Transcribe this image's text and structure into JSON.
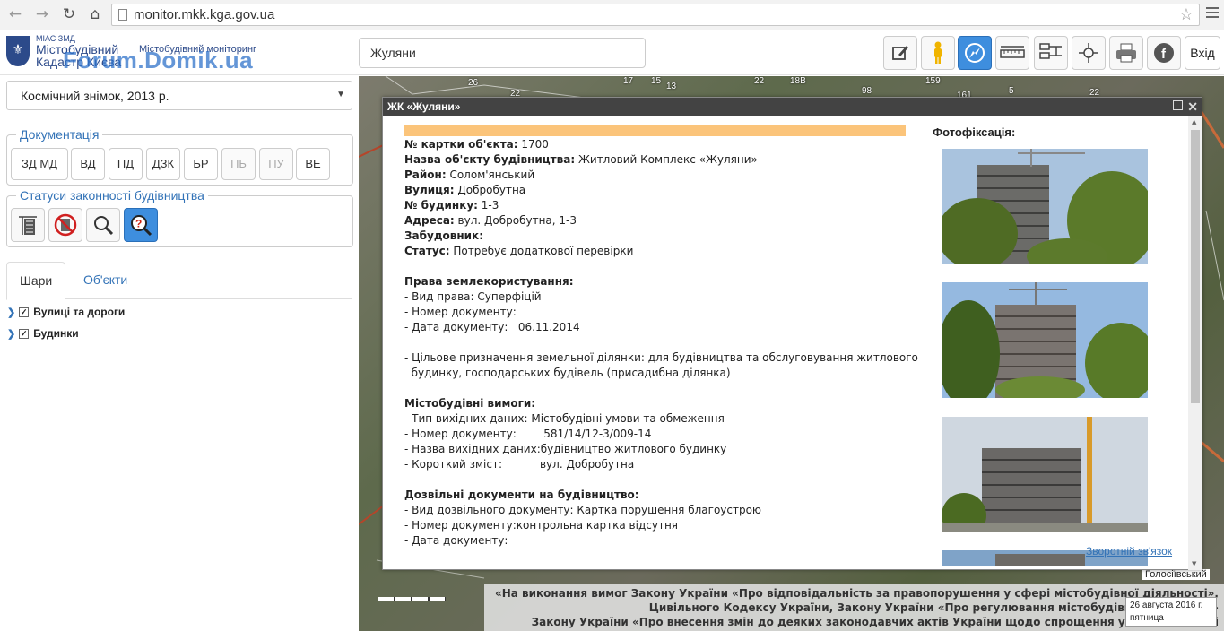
{
  "browser": {
    "url": "monitor.mkk.kga.gov.ua"
  },
  "header": {
    "logo_small": "МІАС ЗМД",
    "logo_line1": "Містобудівний",
    "logo_line2": "Кадастр Києва",
    "logo_sub": "Містобудівний моніторинг",
    "watermark": "Forum.Domik.ua",
    "search_value": "Жуляни",
    "exit_label": "Вхід"
  },
  "left": {
    "basemap_select": "Космічний знімок, 2013 р.",
    "docs_legend": "Документація",
    "doc_buttons": [
      "ЗД МД",
      "ВД",
      "ПД",
      "ДЗК",
      "БР",
      "ПБ",
      "ПУ",
      "ВЕ"
    ],
    "status_legend": "Статуси законності будівництва",
    "tabs": [
      "Шари",
      "Об'єкти"
    ],
    "layers": [
      "Вулиці та дороги",
      "Будинки"
    ]
  },
  "map": {
    "labels": [
      "26",
      "22",
      "17",
      "15",
      "13",
      "22",
      "18В",
      "98",
      "159",
      "161",
      "5",
      "22"
    ],
    "district": "Голосіївський",
    "legal_lines": [
      "«На виконання вимог Закону України «Про відповідальність за правопорушення у сфері містобудівної діяльності»,",
      "Цивільного Кодексу України, Закону України «Про регулювання містобудівної діяльності»",
      "Закону України «Про внесення змін до деяких законодавчих актів України щодо спрощення умов ведення бі"
    ],
    "date": "26 августа 2016 г.",
    "weekday": "пятница"
  },
  "popup": {
    "title": "ЖК «Жуляни»",
    "photos_title": "Фотофіксація:",
    "feedback": "Зворотній зв'язок",
    "rows": [
      {
        "k": "№ картки об'єкта:",
        "v": " 1700"
      },
      {
        "k": "Назва об'єкту будівництва:",
        "v": " Житловий Комплекс «Жуляни»"
      },
      {
        "k": "Район:",
        "v": " Солом'янський"
      },
      {
        "k": "Вулиця:",
        "v": " Добробутна"
      },
      {
        "k": "№ будинку:",
        "v": " 1-3"
      },
      {
        "k": "Адреса:",
        "v": " вул. Добробутна, 1-3"
      },
      {
        "k": "Забудовник:",
        "v": ""
      },
      {
        "k": "Статус:",
        "v": " Потребує додаткової перевірки"
      },
      {
        "k": "",
        "v": ""
      },
      {
        "k": "Права землекористування:",
        "v": ""
      },
      {
        "k": "",
        "v": "- Вид права: Суперфіцій"
      },
      {
        "k": "",
        "v": "- Номер документу:"
      },
      {
        "k": "",
        "v": "- Дата документу:   06.11.2014"
      },
      {
        "k": "",
        "v": ""
      },
      {
        "k": "",
        "v": "- Цільове призначення земельної ділянки: для будівництва та обслуговування житлового"
      },
      {
        "k": "",
        "v": "  будинку, господарських будівель (присадибна ділянка)"
      },
      {
        "k": "",
        "v": ""
      },
      {
        "k": "Містобудівні вимоги:",
        "v": ""
      },
      {
        "k": "",
        "v": "- Тип вихідних даних: Містобудівні умови та обмеження"
      },
      {
        "k": "",
        "v": "- Номер документу:        581/14/12-3/009-14"
      },
      {
        "k": "",
        "v": "- Назва вихідних даних:будівництво житлового будинку"
      },
      {
        "k": "",
        "v": "- Короткий зміст:           вул. Добробутна"
      },
      {
        "k": "",
        "v": ""
      },
      {
        "k": "Дозвільні документи на будівництво:",
        "v": ""
      },
      {
        "k": "",
        "v": "- Вид дозвільного документу: Картка порушення благоустрою"
      },
      {
        "k": "",
        "v": "- Номер документу:контрольна картка відсутня"
      },
      {
        "k": "",
        "v": "- Дата документу:"
      }
    ]
  }
}
